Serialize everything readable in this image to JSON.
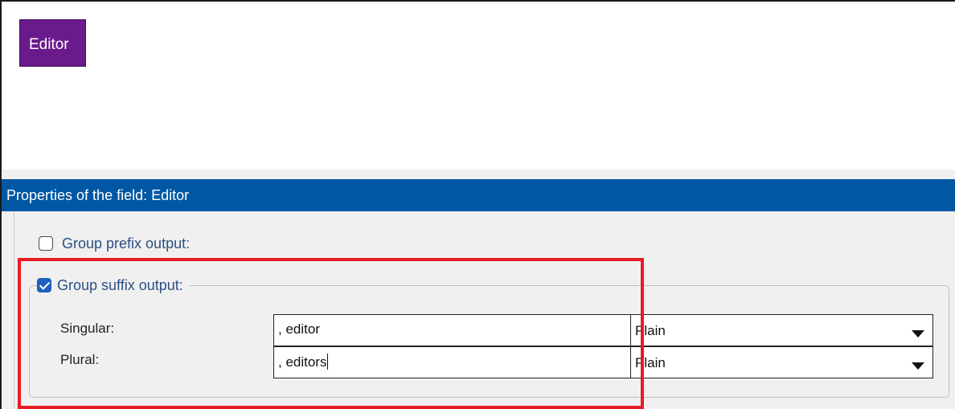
{
  "canvas": {
    "field_chip_label": "Editor"
  },
  "properties": {
    "header_title": "Properties of the field: Editor",
    "group_prefix": {
      "label": "Group prefix output:",
      "checked": false
    },
    "group_suffix": {
      "label": "Group suffix output:",
      "checked": true,
      "rows": [
        {
          "label": "Singular:",
          "value": ", editor",
          "style": "Plain"
        },
        {
          "label": "Plural:",
          "value": ", editors",
          "style": "Plain"
        }
      ]
    }
  },
  "icons": {
    "checkbox_checked": "checkmark-icon",
    "dropdown": "caret-down-icon"
  },
  "colors": {
    "header_blue": "#0057a3",
    "field_chip_purple": "#6a1a8a",
    "highlight_red": "#e81a23",
    "checkbox_blue": "#1f5fbf",
    "label_blue": "#2b4f82"
  }
}
